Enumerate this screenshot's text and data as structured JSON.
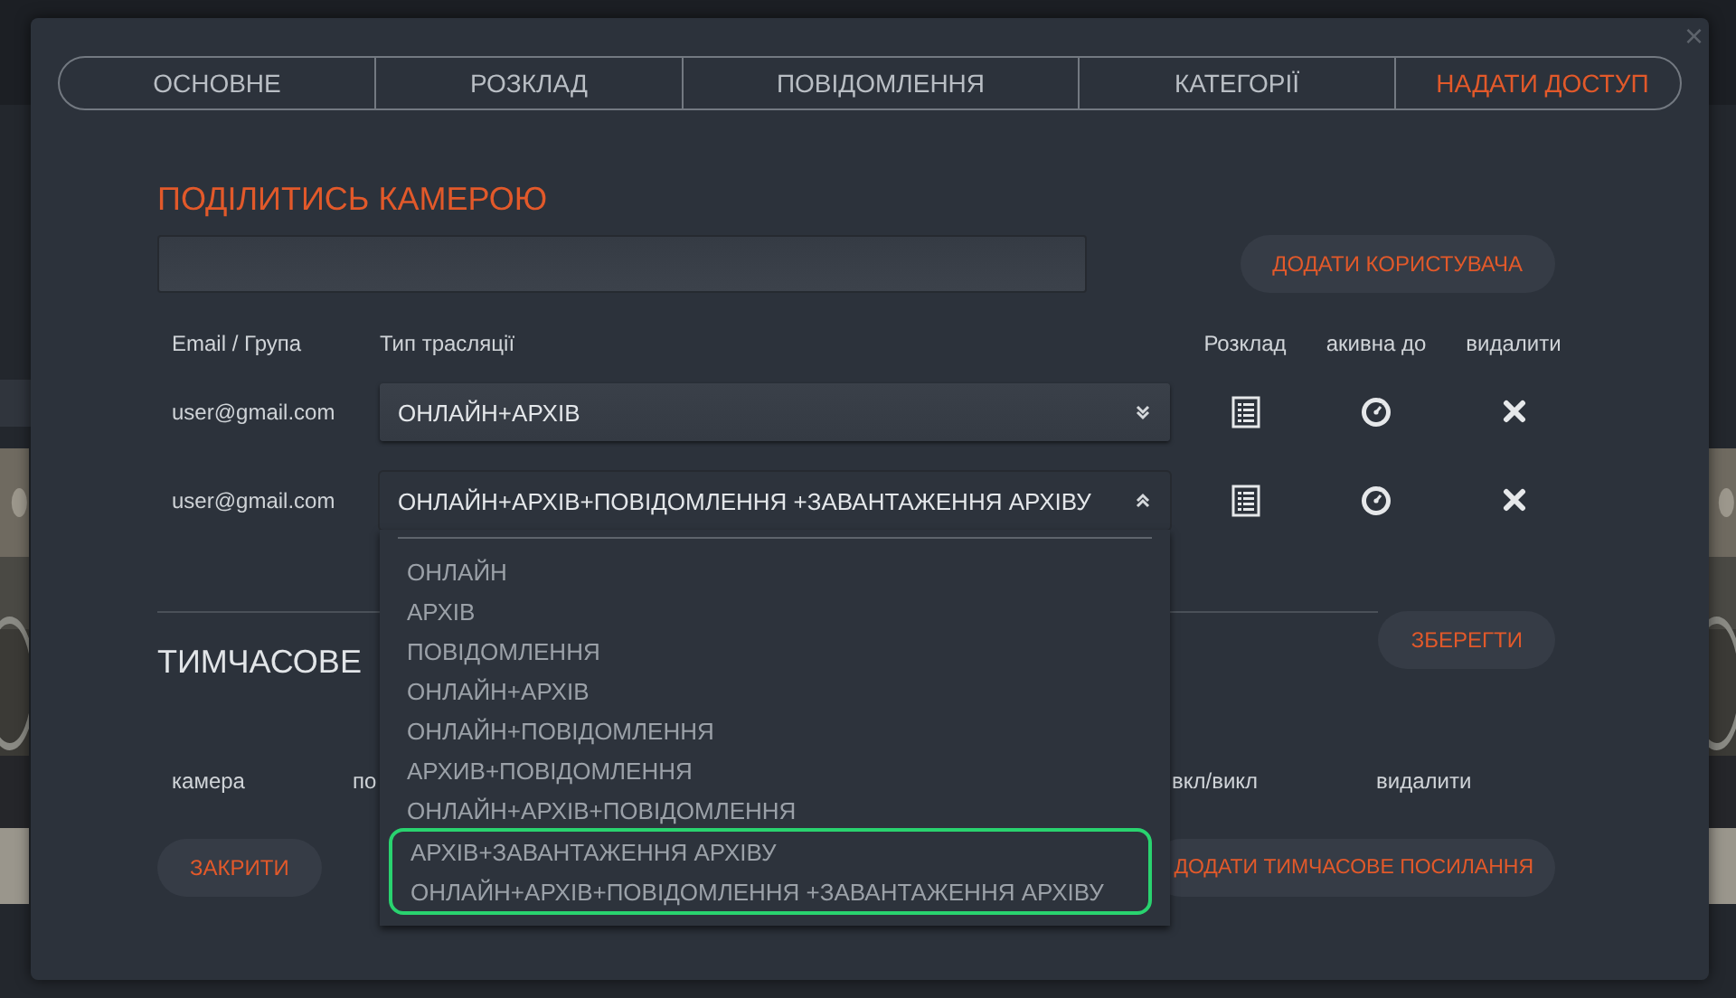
{
  "dialog": {
    "close": "×",
    "tabs": [
      {
        "label": "ОСНОВНЕ",
        "selected": false
      },
      {
        "label": "РОЗКЛАД",
        "selected": false
      },
      {
        "label": "ПОВІДОМЛЕННЯ",
        "selected": false
      },
      {
        "label": "КАТЕГОРІЇ",
        "selected": false
      },
      {
        "label": "НАДАТИ ДОСТУП",
        "selected": true
      }
    ],
    "share": {
      "title": "ПОДІЛИТИСЬ КАМЕРОЮ",
      "add_button": "ДОДАТИ КОРИСТУВАЧА",
      "columns": [
        "Email / Група",
        "Тип трасляції",
        "Розклад",
        "акивна до",
        "видалити"
      ],
      "rows": [
        {
          "email": "user@gmail.com",
          "type": "ОНЛАЙН+АРХІВ",
          "expanded": false
        },
        {
          "email": "user@gmail.com",
          "type": "ОНЛАЙН+АРХІВ+ПОВІДОМЛЕННЯ +ЗАВАНТАЖЕННЯ АРХІВУ",
          "expanded": true
        }
      ],
      "save_button": "ЗБЕРЕГТИ"
    },
    "dropdown_options": [
      {
        "label": "ОНЛАЙН",
        "highlighted": false
      },
      {
        "label": "АРХІВ",
        "highlighted": false
      },
      {
        "label": "ПОВІДОМЛЕННЯ",
        "highlighted": false
      },
      {
        "label": "ОНЛАЙН+АРХІВ",
        "highlighted": false
      },
      {
        "label": "ОНЛАЙН+ПОВІДОМЛЕННЯ",
        "highlighted": false
      },
      {
        "label": "АРХИВ+ПОВІДОМЛЕННЯ",
        "highlighted": false
      },
      {
        "label": "ОНЛАЙН+АРХІВ+ПОВІДОМЛЕННЯ",
        "highlighted": false
      },
      {
        "label": "АРХІВ+ЗАВАНТАЖЕННЯ АРХІВУ",
        "highlighted": true
      },
      {
        "label": "ОНЛАЙН+АРХІВ+ПОВІДОМЛЕННЯ +ЗАВАНТАЖЕННЯ АРХІВУ",
        "highlighted": true
      }
    ],
    "temporary": {
      "title": "ТИМЧАСОВЕ",
      "columns": [
        "камера",
        "по",
        "вкл/викл",
        "видалити"
      ],
      "close_button": "ЗАКРИТИ",
      "add_button": "ДОДАТИ ТИМЧАСОВЕ ПОСИЛАННЯ"
    }
  }
}
